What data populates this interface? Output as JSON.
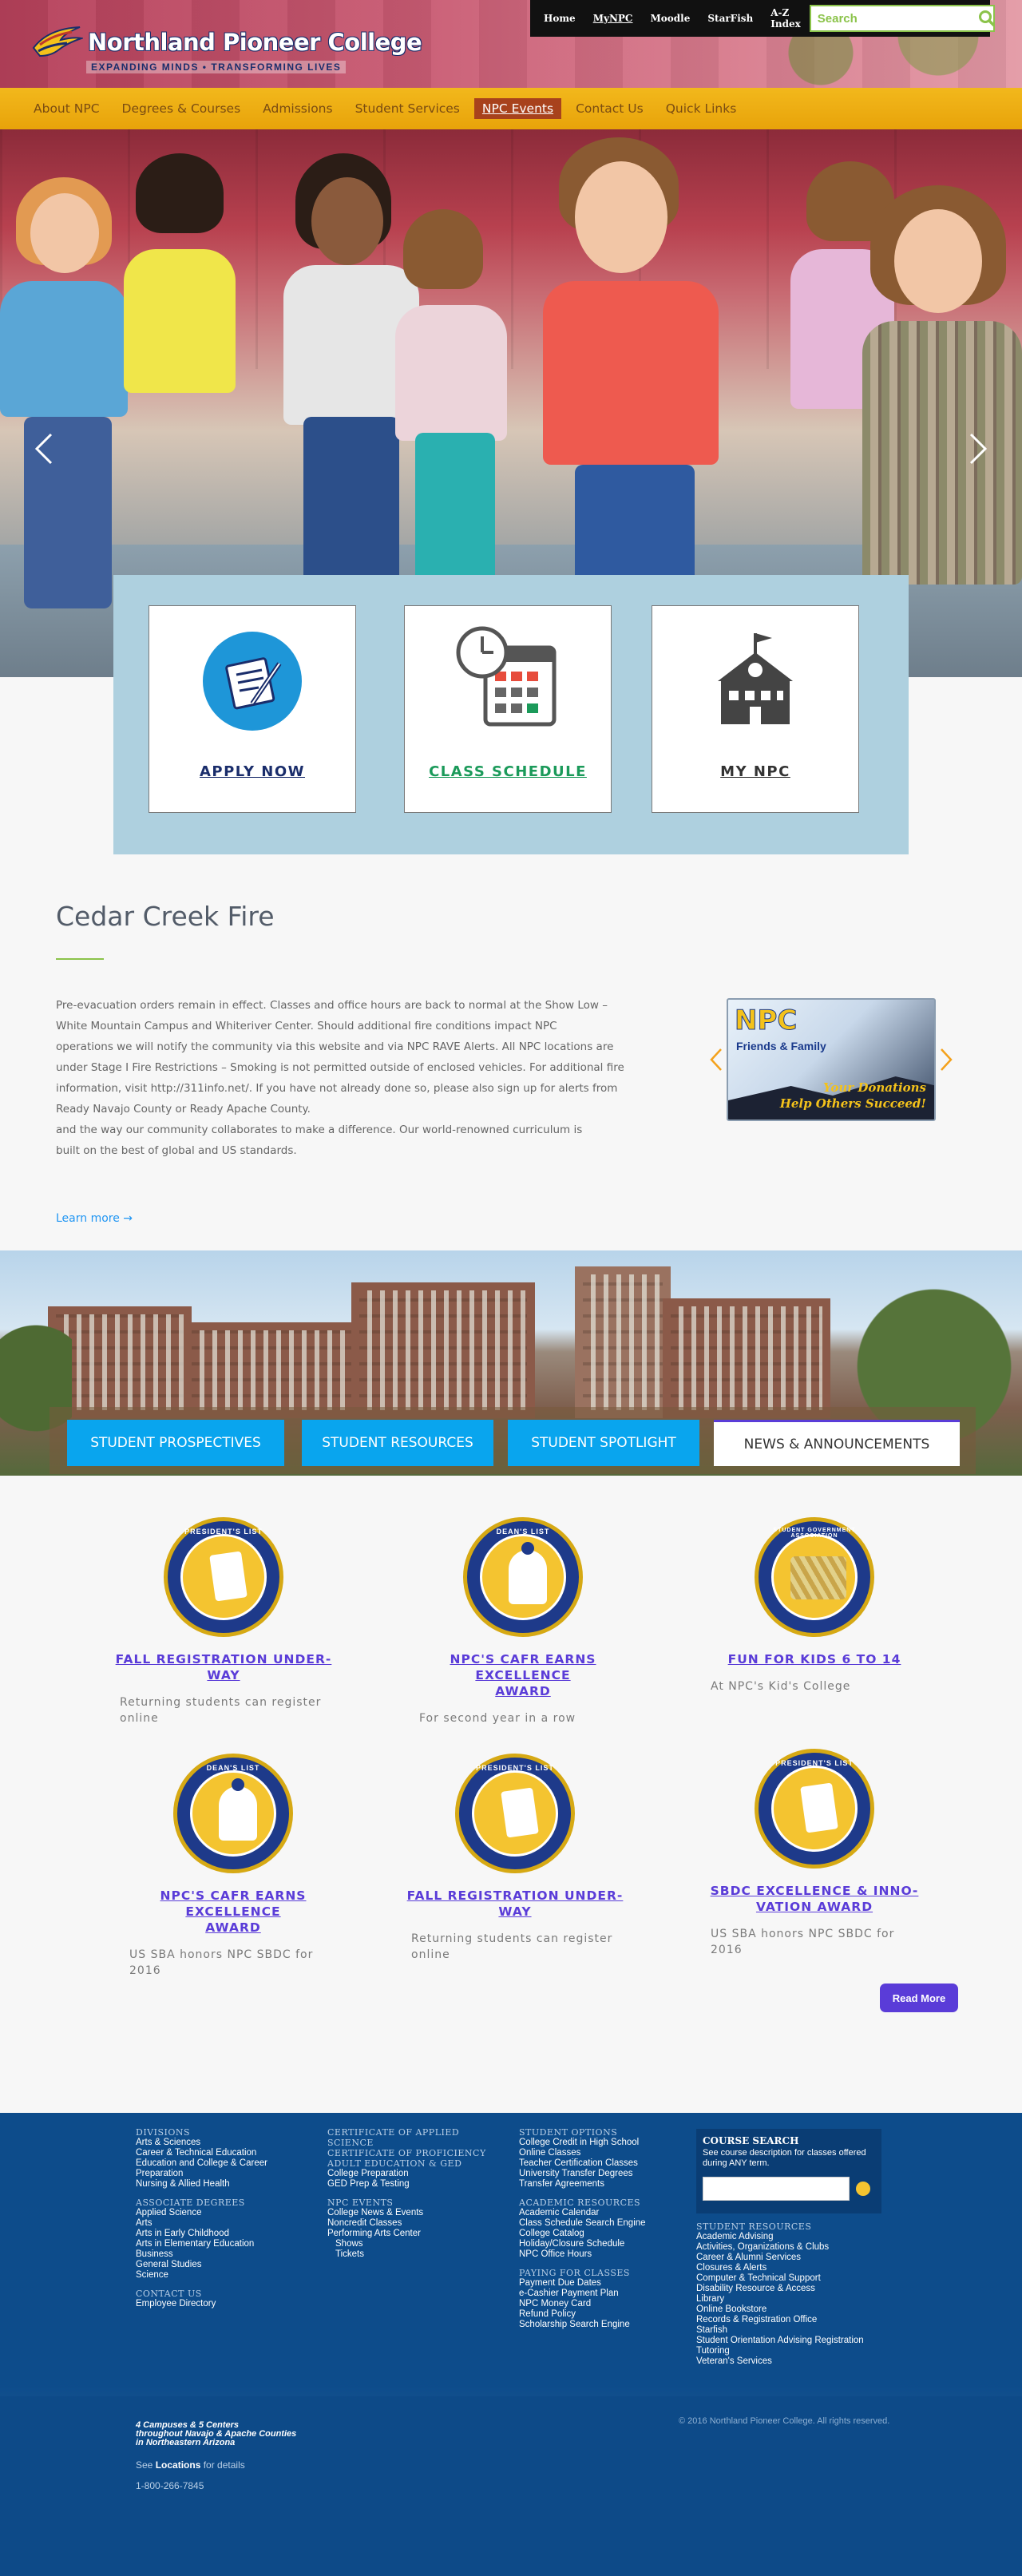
{
  "header": {
    "college_name": "Northland Pioneer College",
    "tagline": "EXPANDING MINDS • TRANSFORMING LIVES",
    "top_links": [
      "Home",
      "MyNPC",
      "Moodle",
      "StarFish",
      "A-Z Index"
    ],
    "search_placeholder": "Search"
  },
  "nav": [
    "About NPC",
    "Degrees & Courses",
    "Admissions",
    "Student Services",
    "NPC Events",
    "Contact Us",
    "Quick Links"
  ],
  "nav_active": "NPC Events",
  "quick_cards": [
    {
      "label": "APPLY NOW",
      "color": "#1a2d6b"
    },
    {
      "label": "CLASS SCHEDULE",
      "color": "#1b9a5a"
    },
    {
      "label": "MY NPC",
      "color": "#333333"
    }
  ],
  "feature": {
    "title": "Cedar Creek Fire",
    "body": [
      "Pre-evacuation orders remain in effect. Classes and office hours are back to normal at the Show Low –",
      "White Mountain Campus and Whiteriver Center. Should additional fire conditions impact NPC",
      "operations we will notify the community via this website and via NPC RAVE Alerts. All NPC locations are",
      "under Stage I Fire Restrictions – Smoking is not permitted outside of enclosed vehicles. For additional fire",
      "information, visit http://311info.net/. If you have not already done so, please also sign up for alerts from",
      "Ready Navajo County or Ready Apache County.",
      "and the way our community collaborates to make a difference. Our world-renowned curriculum is",
      "built on the best of global and US standards."
    ],
    "learn_more": "Learn more →",
    "promo": {
      "npc": "NPC",
      "friends": "Friends & Family",
      "slogan_1": "Your Donations",
      "slogan_2": "Help Others Succeed!"
    }
  },
  "tabs": [
    "STUDENT PROSPECTIVES",
    "STUDENT RESOURCES",
    "STUDENT SPOTLIGHT",
    "NEWS & ANNOUNCEMENTS"
  ],
  "tab_active": "NEWS & ANNOUNCEMENTS",
  "news": [
    {
      "title": "FALL REGISTRATION UNDER-\nWAY",
      "subtitle": "Returning students can register online",
      "badge": "PRESIDENT'S LIST"
    },
    {
      "title": "NPC'S CAFR EARNS EXCELLENCE\nAWARD",
      "subtitle": "For second year in a row",
      "badge": "DEAN'S LIST"
    },
    {
      "title": "FUN FOR KIDS 6 TO 14",
      "subtitle": "At NPC's Kid's College",
      "badge": "STUDENT GOVERNMENT ASSOCIATION"
    },
    {
      "title": "NPC'S CAFR EARNS EXCELLENCE\nAWARD",
      "subtitle": "US SBA honors NPC SBDC for 2016",
      "badge": "DEAN'S LIST"
    },
    {
      "title": "FALL REGISTRATION UNDER-\nWAY",
      "subtitle": "Returning students can register online",
      "badge": "PRESIDENT'S LIST"
    },
    {
      "title": "SBDC EXCELLENCE & INNO-\nVATION AWARD",
      "subtitle": "US SBA honors NPC SBDC for 2016",
      "badge": "PRESIDENT'S LIST"
    }
  ],
  "read_more": "Read More",
  "footer": {
    "col1": [
      {
        "h": "DIVISIONS"
      },
      "Arts & Sciences",
      "Career & Technical Education",
      "Education and College & Career",
      "Preparation",
      "Nursing & Allied Health",
      {
        "gap": true
      },
      {
        "h": "ASSOCIATE DEGREES"
      },
      "Applied Science",
      "Arts",
      "Arts in Early Childhood",
      "Arts in Elementary Education",
      "Business",
      "General Studies",
      "Science",
      {
        "gap": true
      },
      {
        "h": "CONTACT US"
      },
      "Employee Directory"
    ],
    "col2": [
      {
        "h": "CERTIFICATE OF APPLIED"
      },
      {
        "h": "SCIENCE"
      },
      {
        "h": "CERTIFICATE OF PROFICIENCY"
      },
      {
        "h": "ADULT EDUCATION & GED"
      },
      "College Preparation",
      "GED Prep & Testing",
      {
        "gap": true
      },
      {
        "h": "NPC EVENTS"
      },
      "College News & Events",
      "Noncredit Classes",
      "Performing Arts Center",
      {
        "ind": "Shows"
      },
      {
        "ind": "Tickets"
      }
    ],
    "col3": [
      {
        "h": "STUDENT OPTIONS"
      },
      "College Credit in High School",
      "Online Classes",
      "Teacher Certification Classes",
      "University Transfer Degrees",
      "Transfer Agreements",
      {
        "gap": true
      },
      {
        "h": "ACADEMIC RESOURCES"
      },
      "Academic Calendar",
      "Class Schedule Search Engine",
      "College Catalog",
      "Holiday/Closure Schedule",
      "NPC Office Hours",
      {
        "gap": true
      },
      {
        "h": "PAYING FOR CLASSES"
      },
      "Payment Due Dates",
      "e-Cashier Payment Plan",
      "NPC Money Card",
      "Refund Policy",
      "Scholarship Search Engine"
    ],
    "col4": [
      {
        "h": "STUDENT RESOURCES"
      },
      "Academic Advising",
      "Activities, Organizations & Clubs",
      "Career & Alumni Services",
      "Closures & Alerts",
      "Computer & Technical Support",
      "Disability Resource & Access",
      "Library",
      "Online Bookstore",
      "Records & Registration Office",
      "Starfish",
      "Student Orientation Advising Registration",
      "Tutoring",
      "Veteran's Services"
    ],
    "course_search": {
      "title": "COURSE SEARCH",
      "desc": "See course description for classes offered during ANY term."
    },
    "campuses_1": "4 Campuses & 5 Centers",
    "campuses_2": "throughout Navajo & Apache Counties",
    "campuses_3": "in Northeastern Arizona",
    "see": "See",
    "locations": "Locations",
    "for_details": "for details",
    "phone": "1-800-266-7845",
    "copyright": "© 2016 Northland Pioneer College. All rights reserved."
  }
}
